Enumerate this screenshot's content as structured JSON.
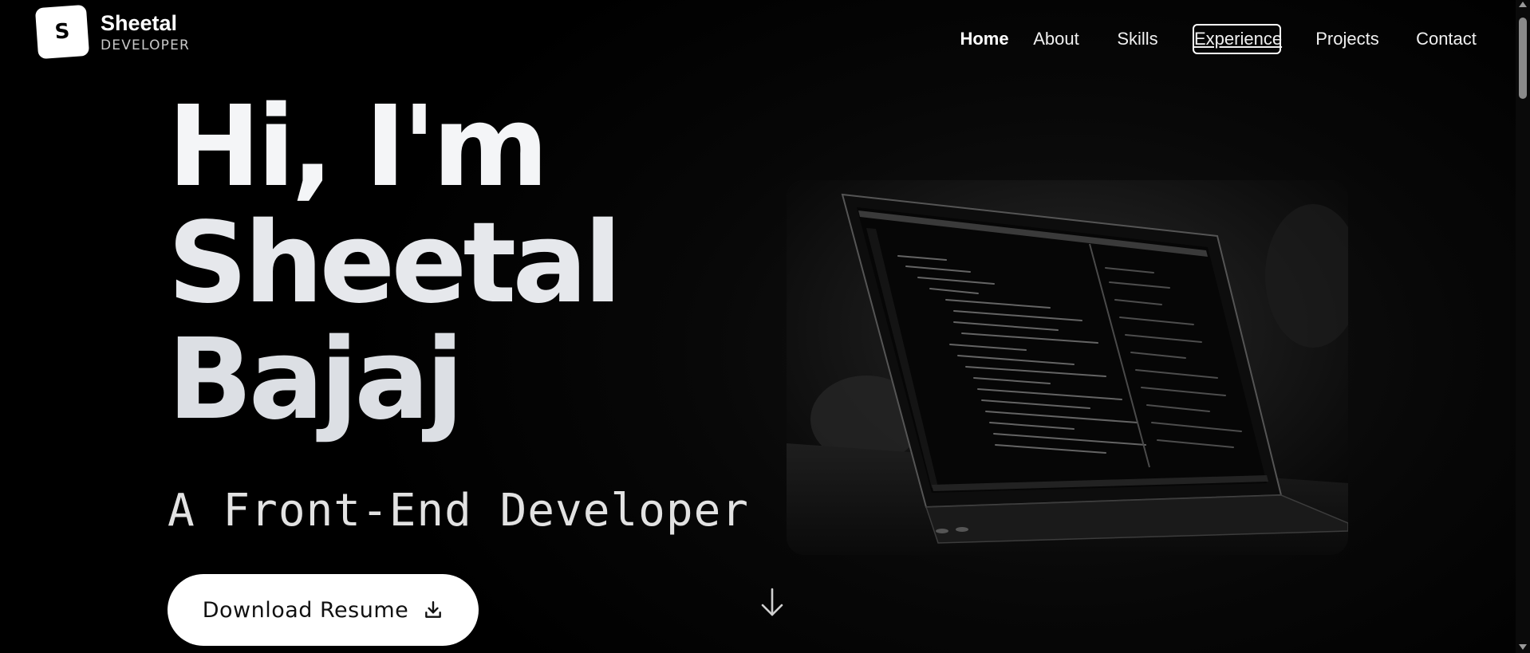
{
  "brand": {
    "logo_letter": "S",
    "name": "Sheetal",
    "role": "DEVELOPER"
  },
  "nav": {
    "items": [
      {
        "label": "Home",
        "state": "active"
      },
      {
        "label": "About",
        "state": "normal"
      },
      {
        "label": "Skills",
        "state": "normal"
      },
      {
        "label": "Experience",
        "state": "focused"
      },
      {
        "label": "Projects",
        "state": "normal"
      },
      {
        "label": "Contact",
        "state": "normal"
      }
    ]
  },
  "hero": {
    "title_lines": [
      "Hi, I'm",
      "Sheetal",
      "Bajaj"
    ],
    "subtitle": "A Front-End Developer",
    "button_label": "Download Resume",
    "button_icon": "download-icon",
    "scroll_icon": "arrow-down-icon",
    "image_alt": "laptop-with-code-editor"
  },
  "colors": {
    "background": "#000000",
    "text": "#ffffff",
    "button_bg": "#ffffff",
    "button_text": "#111111"
  }
}
